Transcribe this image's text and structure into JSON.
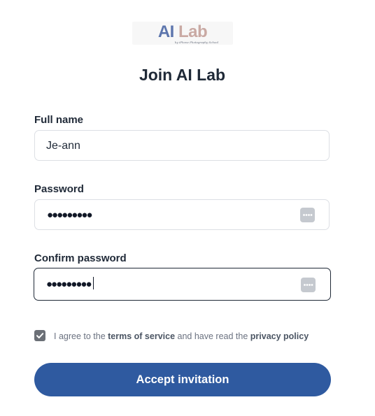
{
  "logo": {
    "part1": "AI",
    "part2": " Lab",
    "tagline": "by iPhone Photography School"
  },
  "title": "Join AI Lab",
  "full_name": {
    "label": "Full name",
    "value": "Je-ann"
  },
  "password": {
    "label": "Password",
    "masked_value": "●●●●●●●●●"
  },
  "confirm_password": {
    "label": "Confirm password",
    "masked_value": "●●●●●●●●●"
  },
  "agreement": {
    "checked": true,
    "prefix": "I agree to the ",
    "terms": "terms of service",
    "middle": " and have read the ",
    "privacy": "privacy policy"
  },
  "submit_label": "Accept invitation",
  "colors": {
    "primary": "#2f5aa0",
    "logo_ai": "#5d76ad",
    "logo_lab": "#c9a9a3"
  },
  "icons": {
    "password_manager": "password-dots-icon",
    "checkbox": "checkmark-icon"
  }
}
